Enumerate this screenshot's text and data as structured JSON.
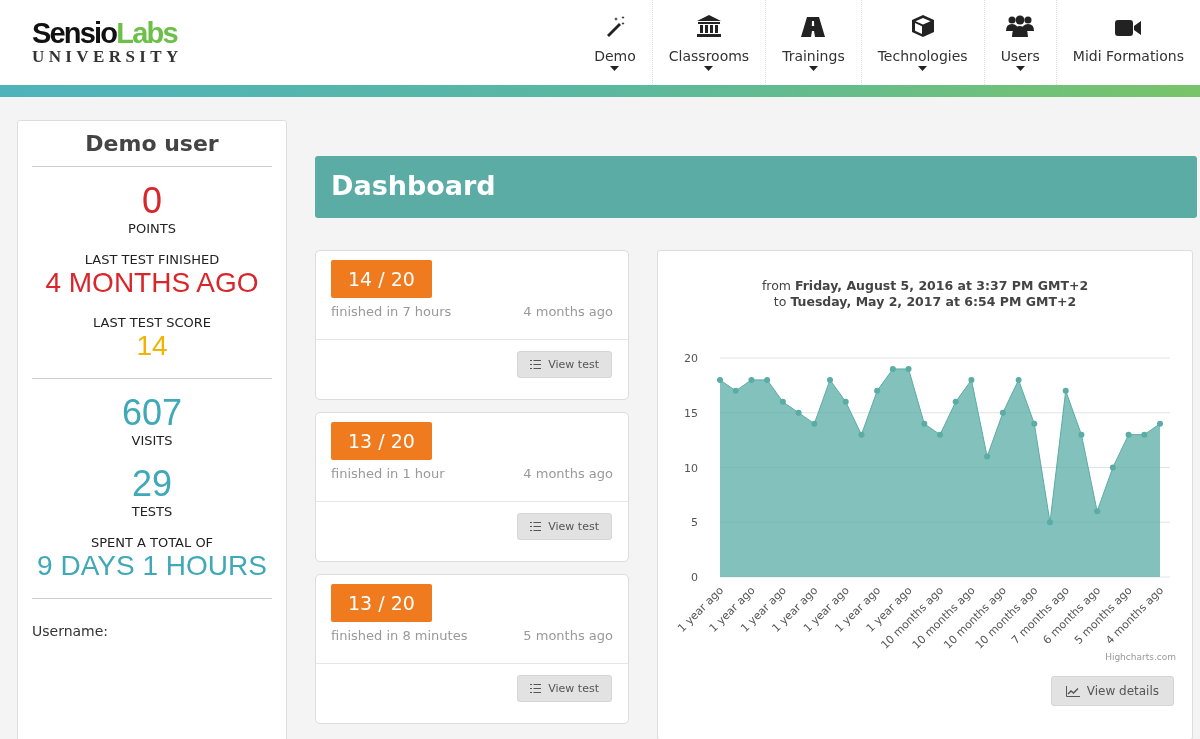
{
  "logo": {
    "brand_dark": "Sensio",
    "brand_light": "Labs",
    "subtitle": "UNIVERSITY"
  },
  "nav": [
    {
      "kind": "wand",
      "label": "Demo",
      "dropdown": true
    },
    {
      "kind": "building",
      "label": "Classrooms",
      "dropdown": true
    },
    {
      "kind": "road",
      "label": "Trainings",
      "dropdown": true
    },
    {
      "kind": "cube",
      "label": "Technologies",
      "dropdown": true
    },
    {
      "kind": "users",
      "label": "Users",
      "dropdown": true
    },
    {
      "kind": "video",
      "label": "Midi Formations",
      "dropdown": false
    }
  ],
  "profile": {
    "name": "Demo user",
    "stats": [
      {
        "kind": "big",
        "value": "0",
        "label": "POINTS",
        "color": "#d9262b"
      },
      {
        "kind": "label_first",
        "label": "LAST TEST FINISHED",
        "value": "4 MONTHS AGO",
        "color": "#d9262b"
      },
      {
        "kind": "label_first",
        "label": "LAST TEST SCORE",
        "value": "14",
        "color": "#f0b400"
      },
      {
        "kind": "divider"
      },
      {
        "kind": "big",
        "value": "607",
        "label": "VISITS",
        "color": "#3fa9b8"
      },
      {
        "kind": "big",
        "value": "29",
        "label": "TESTS",
        "color": "#3fa9b8"
      },
      {
        "kind": "label_first",
        "label": "SPENT A TOTAL OF",
        "value": "9 DAYS 1 HOURS",
        "color": "#3fa9b8"
      },
      {
        "kind": "divider"
      }
    ],
    "username_label": "Username:"
  },
  "dashboard": {
    "title": "Dashboard"
  },
  "tests": [
    {
      "score": "14 / 20",
      "duration": "finished in 7 hours",
      "when": "4 months ago",
      "button": "View test"
    },
    {
      "score": "13 / 20",
      "duration": "finished in 1 hour",
      "when": "4 months ago",
      "button": "View test"
    },
    {
      "score": "13 / 20",
      "duration": "finished in 8 minutes",
      "when": "5 months ago",
      "button": "View test"
    }
  ],
  "chart": {
    "credit": "Highcharts.com",
    "button": "View details",
    "chart_data": {
      "type": "area",
      "title": "from **Friday, August 5, 2016 at 3:37 PM GMT+2**\nto **Tuesday, May 2, 2017 at 6:54 PM GMT+2**",
      "categories": [
        "1 year ago",
        null,
        "1 year ago",
        null,
        "1 year ago",
        null,
        "1 year ago",
        null,
        "1 year ago",
        null,
        "1 year ago",
        null,
        "1 year ago",
        null,
        "10 months ago",
        null,
        "10 months ago",
        null,
        "10 months ago",
        null,
        "10 months ago",
        null,
        "7 months ago",
        null,
        "6 months ago",
        null,
        "5 months ago",
        null,
        "4 months ago"
      ],
      "series": [
        {
          "color": "#5aaca5",
          "values": [
            18,
            17,
            18,
            18,
            16,
            15,
            14,
            18,
            16,
            13,
            17,
            19,
            19,
            14,
            13,
            16,
            18,
            11,
            15,
            18,
            14,
            5,
            17,
            13,
            6,
            10,
            13,
            13,
            14
          ]
        }
      ],
      "ylim": [
        0,
        20
      ],
      "yticks": [
        0,
        5,
        10,
        15,
        20
      ],
      "grid": true
    }
  }
}
